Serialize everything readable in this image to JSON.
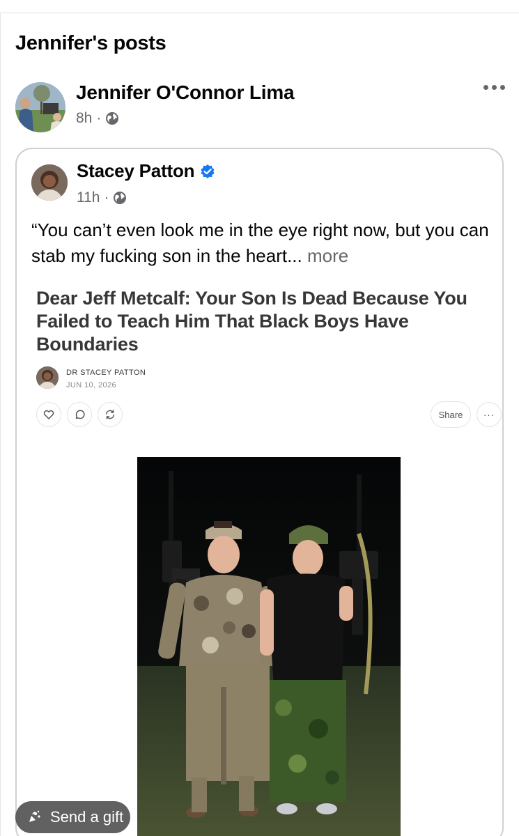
{
  "section": {
    "title": "Jennifer's posts"
  },
  "post": {
    "author": "Jennifer O'Connor Lima",
    "time": "8h",
    "separator": "·",
    "audience_icon": "globe-icon",
    "menu_icon": "more-horizontal-icon"
  },
  "shared": {
    "author": "Stacey Patton",
    "verified_icon": "verified-badge-icon",
    "time": "11h",
    "separator": "·",
    "audience_icon": "globe-icon",
    "text": "“You can’t even look me in the eye right now, but you can stab my fucking son in the heart...",
    "more_label": "more"
  },
  "article": {
    "title": "Dear Jeff Metcalf: Your Son Is Dead Because You Failed to Teach Him That Black Boys Have Boundaries",
    "byline": "DR STACEY PATTON",
    "date": "JUN 10, 2026",
    "actions": {
      "like_icon": "heart-icon",
      "comment_icon": "comment-icon",
      "restack_icon": "restack-icon",
      "share_label": "Share",
      "more_label": "···"
    },
    "photo_icon": "photo-image"
  },
  "gift": {
    "label": "Send a gift",
    "icon": "gift-icon"
  },
  "colors": {
    "text": "#050505",
    "secondary": "#65676b",
    "verified": "#1877f2",
    "card_border": "#ced0d4",
    "article_text": "#363737"
  }
}
